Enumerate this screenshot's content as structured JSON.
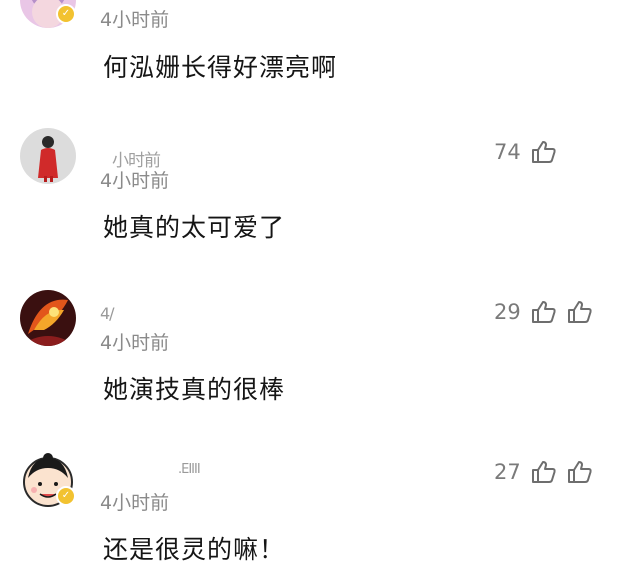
{
  "comments": [
    {
      "timestamp": "4小时前",
      "text": "何泓姗长得好漂亮啊",
      "username": "",
      "likes": "",
      "verified": true
    },
    {
      "timestamp": "4小时前",
      "text": "她真的太可爱了",
      "username": "小时前",
      "likes": "74",
      "verified": false
    },
    {
      "timestamp": "4小时前",
      "text": "她演技真的很棒",
      "username": "4/",
      "likes": "29",
      "verified": false
    },
    {
      "timestamp": "4小时前",
      "text": "还是很灵的嘛！",
      "username": ".ΕΙΙΙΙ",
      "likes": "27",
      "verified": true
    }
  ],
  "icons": {
    "like": "thumbs-up-outline-icon",
    "dislike": "thumbs-down-outline-icon"
  },
  "colors": {
    "verified_badge": "#f2c230",
    "timestamp": "#8a8a8a",
    "comment_text": "#151515"
  }
}
